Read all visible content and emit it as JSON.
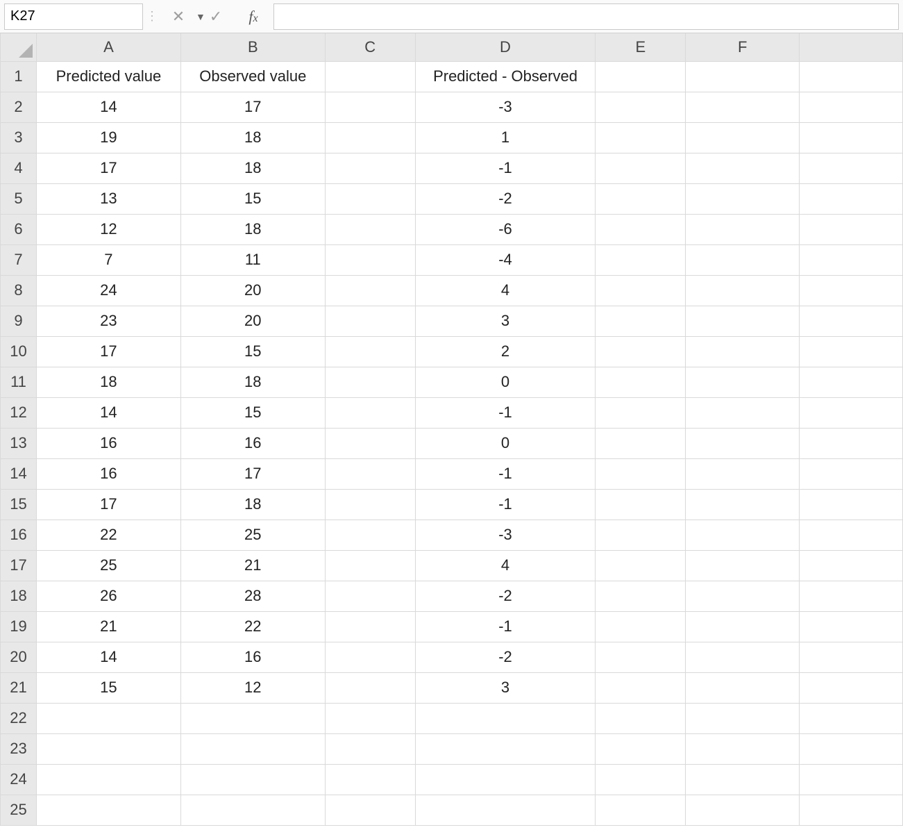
{
  "namebox": {
    "value": "K27"
  },
  "formula": {
    "value": ""
  },
  "columns": [
    "A",
    "B",
    "C",
    "D",
    "E",
    "F"
  ],
  "row_count": 25,
  "headers": {
    "A": "Predicted value",
    "B": "Observed value",
    "C": "",
    "D": "Predicted - Observed",
    "E": "",
    "F": ""
  },
  "rows": [
    {
      "A": "14",
      "B": "17",
      "C": "",
      "D": "-3",
      "E": "",
      "F": ""
    },
    {
      "A": "19",
      "B": "18",
      "C": "",
      "D": "1",
      "E": "",
      "F": ""
    },
    {
      "A": "17",
      "B": "18",
      "C": "",
      "D": "-1",
      "E": "",
      "F": ""
    },
    {
      "A": "13",
      "B": "15",
      "C": "",
      "D": "-2",
      "E": "",
      "F": ""
    },
    {
      "A": "12",
      "B": "18",
      "C": "",
      "D": "-6",
      "E": "",
      "F": ""
    },
    {
      "A": "7",
      "B": "11",
      "C": "",
      "D": "-4",
      "E": "",
      "F": ""
    },
    {
      "A": "24",
      "B": "20",
      "C": "",
      "D": "4",
      "E": "",
      "F": ""
    },
    {
      "A": "23",
      "B": "20",
      "C": "",
      "D": "3",
      "E": "",
      "F": ""
    },
    {
      "A": "17",
      "B": "15",
      "C": "",
      "D": "2",
      "E": "",
      "F": ""
    },
    {
      "A": "18",
      "B": "18",
      "C": "",
      "D": "0",
      "E": "",
      "F": ""
    },
    {
      "A": "14",
      "B": "15",
      "C": "",
      "D": "-1",
      "E": "",
      "F": ""
    },
    {
      "A": "16",
      "B": "16",
      "C": "",
      "D": "0",
      "E": "",
      "F": ""
    },
    {
      "A": "16",
      "B": "17",
      "C": "",
      "D": "-1",
      "E": "",
      "F": ""
    },
    {
      "A": "17",
      "B": "18",
      "C": "",
      "D": "-1",
      "E": "",
      "F": ""
    },
    {
      "A": "22",
      "B": "25",
      "C": "",
      "D": "-3",
      "E": "",
      "F": ""
    },
    {
      "A": "25",
      "B": "21",
      "C": "",
      "D": "4",
      "E": "",
      "F": ""
    },
    {
      "A": "26",
      "B": "28",
      "C": "",
      "D": "-2",
      "E": "",
      "F": ""
    },
    {
      "A": "21",
      "B": "22",
      "C": "",
      "D": "-1",
      "E": "",
      "F": ""
    },
    {
      "A": "14",
      "B": "16",
      "C": "",
      "D": "-2",
      "E": "",
      "F": ""
    },
    {
      "A": "15",
      "B": "12",
      "C": "",
      "D": "3",
      "E": "",
      "F": ""
    }
  ]
}
